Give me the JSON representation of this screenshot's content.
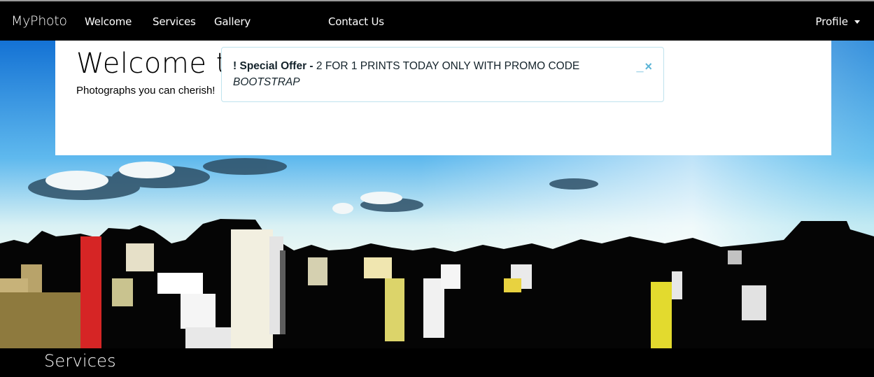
{
  "navbar": {
    "brand": "MyPhoto",
    "links": [
      "Welcome",
      "Services",
      "Gallery",
      "Contact Us"
    ],
    "profile": "Profile"
  },
  "jumbotron": {
    "title": "Welcome to MyPhoto",
    "tagline": "Photographs you can cherish!"
  },
  "alert": {
    "icon": "!",
    "heading": "Special Offer -",
    "message": "2 FOR 1 PRINTS TODAY ONLY WITH PROMO CODE",
    "promo": "BOOTSTRAP",
    "minimize": "_",
    "close": "×"
  },
  "section": {
    "heading": "Services"
  },
  "colors": {
    "navbar_bg": "#000000",
    "alert_border": "#bfe3ee",
    "alert_close": "#5ab4d6",
    "sky": "#1f8fe0"
  }
}
